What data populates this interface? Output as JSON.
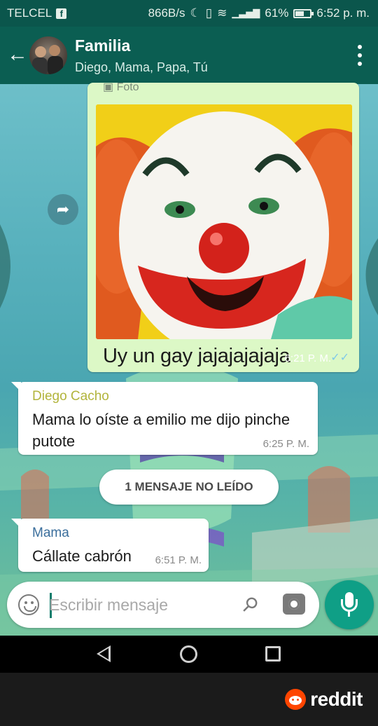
{
  "status_bar": {
    "carrier": "TELCEL",
    "carrier_icon": "facebook-icon",
    "network_speed": "866B/s",
    "battery_percent": "61%",
    "battery_level": 0.61,
    "time": "6:52 p. m."
  },
  "header": {
    "title": "Familia",
    "participants": "Diego, Mama, Papa, Tú"
  },
  "messages": {
    "photo": {
      "label": "Foto",
      "caption": "Uy un gay jajajajajaja",
      "time": "6:21 P. M.",
      "status": "✓✓"
    },
    "diego": {
      "sender": "Diego Cacho",
      "text": "Mama lo oíste a emilio me dijo pinche putote",
      "time": "6:25 P. M."
    },
    "unread_divider": "1 MENSAJE NO LEÍDO",
    "mama": {
      "sender": "Mama",
      "text": "Cállate cabrón",
      "time": "6:51 P. M."
    }
  },
  "composer": {
    "placeholder": "Escribir mensaje"
  },
  "footer": {
    "brand": "reddit"
  },
  "colors": {
    "header_bg": "#0b5e52",
    "outgoing_bubble": "#dcf8c6",
    "mic_button": "#0f9f86",
    "reddit_orange": "#ff4500"
  }
}
